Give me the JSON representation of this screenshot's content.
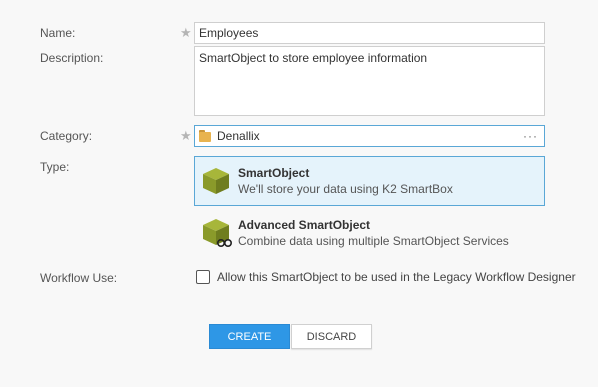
{
  "form": {
    "name_label": "Name:",
    "name_value": "Employees",
    "description_label": "Description:",
    "description_value": "SmartObject to store employee information",
    "category_label": "Category:",
    "category_value": "Denallix",
    "category_browse": "···",
    "required_mark": "★",
    "type_label": "Type:",
    "types": [
      {
        "title": "SmartObject",
        "description": "We'll store your data using K2 SmartBox",
        "icon": "smartobject-cube-icon",
        "selected": true
      },
      {
        "title": "Advanced SmartObject",
        "description": "Combine data using multiple SmartObject Services",
        "icon": "advanced-smartobject-cube-icon",
        "selected": false
      }
    ],
    "workflow_label": "Workflow Use:",
    "workflow_checkbox_label": "Allow this SmartObject to be used in the Legacy Workflow Designer",
    "workflow_checked": false
  },
  "buttons": {
    "create": "CREATE",
    "discard": "DISCARD"
  },
  "colors": {
    "accent": "#2e97e6",
    "selected_bg": "#e5f3fb",
    "selected_border": "#5aa7d6",
    "cube_green": "#8a9a2a",
    "folder": "#e8b34f"
  }
}
